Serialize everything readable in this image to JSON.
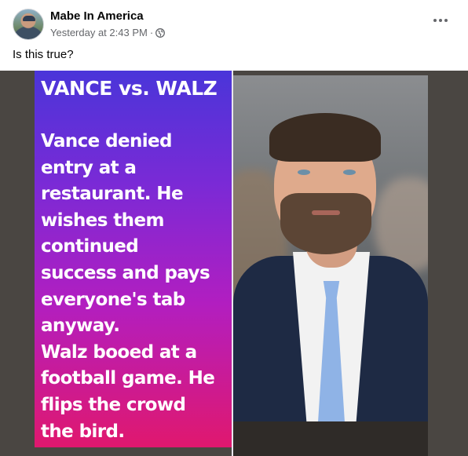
{
  "post": {
    "author": "Mabe In America",
    "timestamp": "Yesterday at 2:43 PM",
    "meta_separator": "·",
    "audience_icon": "globe-icon",
    "more_icon": "more-options-icon",
    "caption": "Is this true?"
  },
  "meme": {
    "title": "VANCE vs. WALZ",
    "body_lines": [
      "Vance denied",
      "entry at a",
      "restaurant. He",
      "wishes them",
      "continued",
      "success and pays",
      "everyone's tab",
      "anyway.",
      "Walz booed at a",
      "football game. He",
      "flips the crowd",
      "the bird."
    ]
  },
  "colors": {
    "meme_gradient_top": "#4a35d9",
    "meme_gradient_bottom": "#e0186e",
    "media_background": "#4a4642"
  }
}
